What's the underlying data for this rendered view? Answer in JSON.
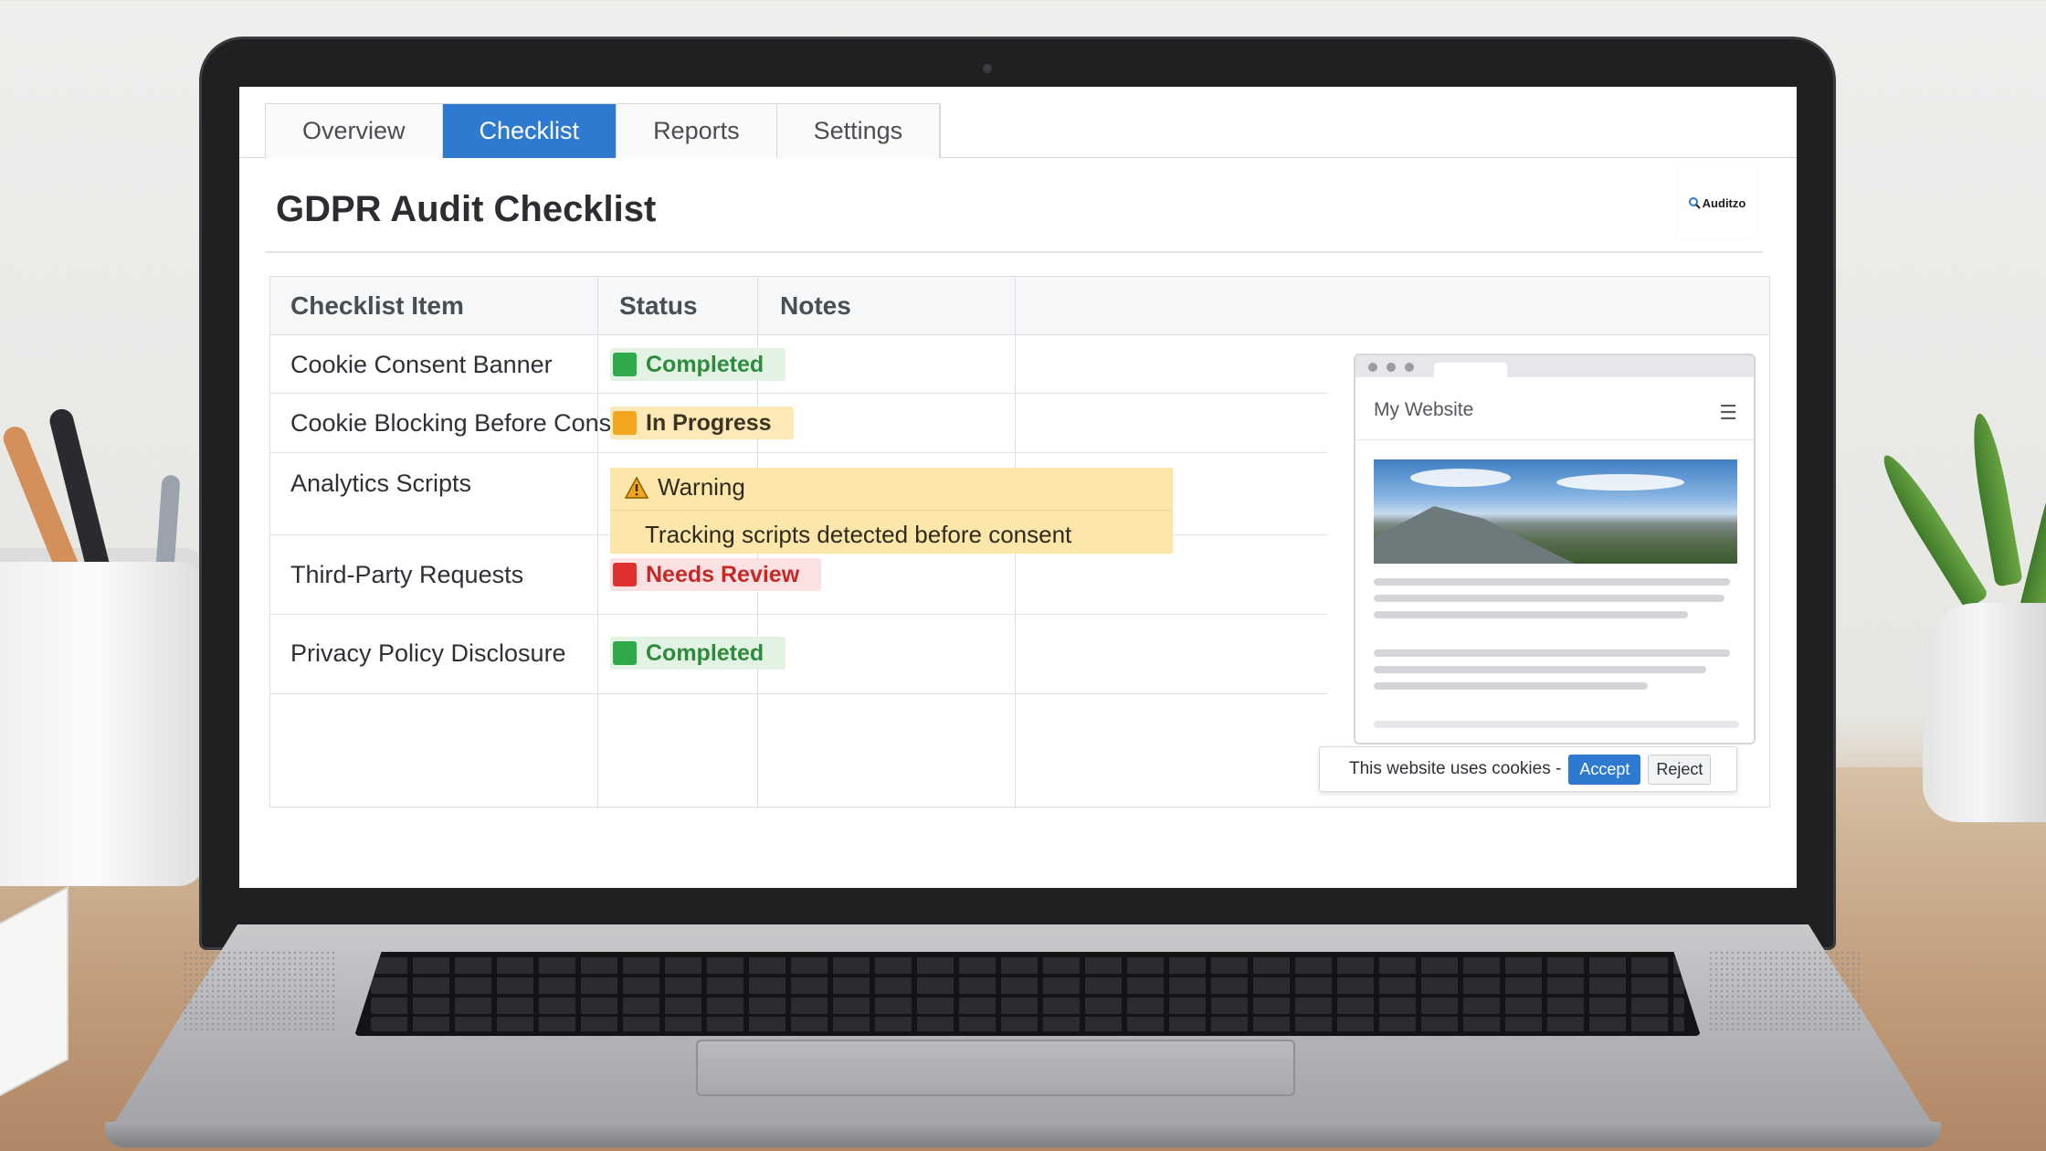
{
  "tabs": [
    {
      "label": "Overview",
      "active": false
    },
    {
      "label": "Checklist",
      "active": true
    },
    {
      "label": "Reports",
      "active": false
    },
    {
      "label": "Settings",
      "active": false
    }
  ],
  "page": {
    "title": "GDPR Audit Checklist",
    "logo_text": "Auditzo"
  },
  "table": {
    "headers": [
      "Checklist Item",
      "Status",
      "Notes"
    ],
    "rows": [
      {
        "item": "Cookie Consent Banner",
        "status": "Completed",
        "status_color": "#2faa4a"
      },
      {
        "item": "Cookie Blocking Before Consent",
        "status": "In Progress",
        "status_color": "#f2a51e"
      },
      {
        "item": "Analytics Scripts",
        "warning_title": "Warning",
        "warning_text": "Tracking scripts detected before consent",
        "status_color": "#fde6a9"
      },
      {
        "item": "Third-Party Requests",
        "status": "Needs Review",
        "status_color": "#e0302f"
      },
      {
        "item": "Privacy Policy Disclosure",
        "status": "Completed",
        "status_color": "#2faa4a"
      }
    ]
  },
  "preview": {
    "site_name": "My Website",
    "cookie_text": "This website uses cookies -",
    "accept_label": "Accept",
    "reject_label": "Reject"
  },
  "colors": {
    "accent": "#2f7ad1"
  },
  "icons": {
    "warning": "warning-triangle-icon",
    "menu": "hamburger-menu-icon",
    "logo": "magnifier-logo-icon"
  }
}
